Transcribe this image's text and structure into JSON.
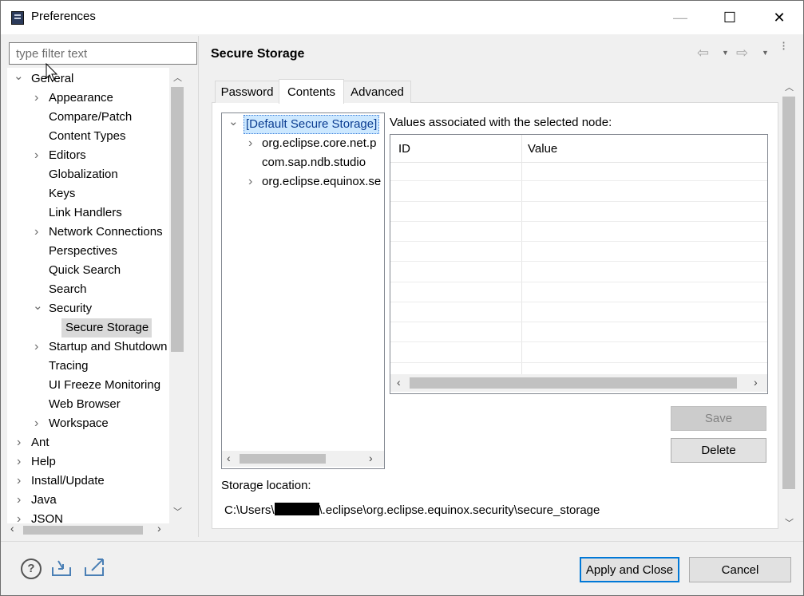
{
  "window": {
    "title": "Preferences",
    "minimize": "—",
    "maximize": "☐",
    "close": "✕"
  },
  "filter": {
    "placeholder": "type filter text"
  },
  "tree": {
    "items": [
      {
        "label": "General",
        "chev": "⌄"
      },
      {
        "label": "Appearance",
        "chev": "›"
      },
      {
        "label": "Compare/Patch"
      },
      {
        "label": "Content Types"
      },
      {
        "label": "Editors",
        "chev": "›"
      },
      {
        "label": "Globalization"
      },
      {
        "label": "Keys"
      },
      {
        "label": "Link Handlers"
      },
      {
        "label": "Network Connections",
        "chev": "›"
      },
      {
        "label": "Perspectives"
      },
      {
        "label": "Quick Search"
      },
      {
        "label": "Search"
      },
      {
        "label": "Security",
        "chev": "⌄"
      },
      {
        "label": "Secure Storage"
      },
      {
        "label": "Startup and Shutdown",
        "chev": "›"
      },
      {
        "label": "Tracing"
      },
      {
        "label": "UI Freeze Monitoring"
      },
      {
        "label": "Web Browser"
      },
      {
        "label": "Workspace",
        "chev": "›"
      },
      {
        "label": "Ant",
        "chev": "›"
      },
      {
        "label": "Help",
        "chev": "›"
      },
      {
        "label": "Install/Update",
        "chev": "›"
      },
      {
        "label": "Java",
        "chev": "›"
      },
      {
        "label": "JSON",
        "chev": "›"
      }
    ]
  },
  "page": {
    "title": "Secure Storage"
  },
  "tabs": [
    "Password",
    "Contents",
    "Advanced"
  ],
  "nodes": {
    "items": [
      {
        "label": "[Default Secure Storage]",
        "chev": "⌄"
      },
      {
        "label": "org.eclipse.core.net.p",
        "chev": "›"
      },
      {
        "label": "com.sap.ndb.studio"
      },
      {
        "label": "org.eclipse.equinox.se",
        "chev": "›"
      }
    ]
  },
  "values": {
    "header": "Values associated with the selected node:",
    "columns": [
      "ID",
      "Value"
    ]
  },
  "buttons": {
    "save": "Save",
    "delete": "Delete",
    "apply_close": "Apply and Close",
    "cancel": "Cancel"
  },
  "storage": {
    "label": "Storage location:",
    "path_prefix": "C:\\Users\\",
    "path_suffix": "\\.eclipse\\org.eclipse.equinox.security\\secure_storage"
  },
  "colors": {
    "selection": "#cce8ff",
    "focus_border": "#0078d7"
  }
}
